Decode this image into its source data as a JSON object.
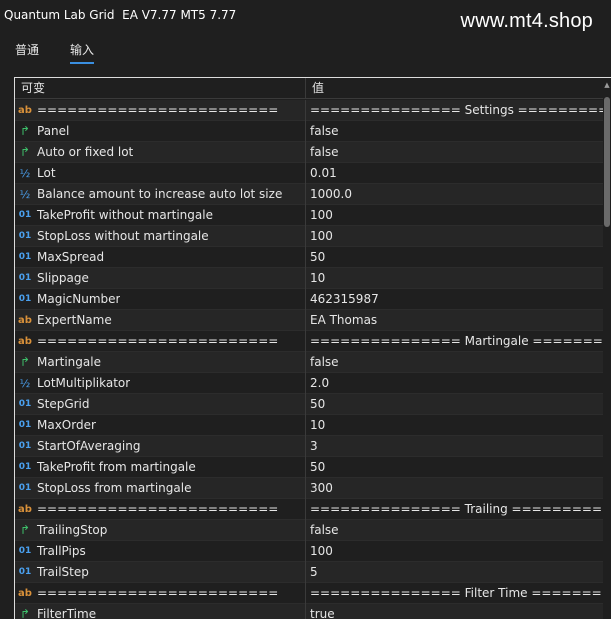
{
  "window": {
    "title": "Quantum Lab Grid  EA V7.77 MT5 7.77"
  },
  "watermark": "www.mt4.shop",
  "tabs": [
    {
      "label": "普通",
      "active": false
    },
    {
      "label": "输入",
      "active": true
    }
  ],
  "table": {
    "headers": {
      "variable": "可变",
      "value": "值"
    },
    "rows": [
      {
        "icon": "ab",
        "name": "========================",
        "value": "=============== Settings =========..."
      },
      {
        "icon": "bool",
        "name": "Panel",
        "value": "false"
      },
      {
        "icon": "bool",
        "name": "Auto or fixed lot",
        "value": "false"
      },
      {
        "icon": "half",
        "name": "Lot",
        "value": "0.01"
      },
      {
        "icon": "half",
        "name": "Balance amount to increase auto lot size",
        "value": "1000.0"
      },
      {
        "icon": "num",
        "name": "TakeProfit without martingale",
        "value": "100"
      },
      {
        "icon": "num",
        "name": "StopLoss without martingale",
        "value": "100"
      },
      {
        "icon": "num",
        "name": "MaxSpread",
        "value": "50"
      },
      {
        "icon": "num",
        "name": "Slippage",
        "value": "10"
      },
      {
        "icon": "num",
        "name": "MagicNumber",
        "value": "462315987"
      },
      {
        "icon": "ab",
        "name": "ExpertName",
        "value": "EA Thomas"
      },
      {
        "icon": "ab",
        "name": "========================",
        "value": "=============== Martingale =======..."
      },
      {
        "icon": "bool",
        "name": "Martingale",
        "value": "false"
      },
      {
        "icon": "half",
        "name": "LotMultiplikator",
        "value": "2.0"
      },
      {
        "icon": "num",
        "name": "StepGrid",
        "value": "50"
      },
      {
        "icon": "num",
        "name": "MaxOrder",
        "value": "10"
      },
      {
        "icon": "num",
        "name": "StartOfAveraging",
        "value": "3"
      },
      {
        "icon": "num",
        "name": "TakeProfit from martingale",
        "value": "50"
      },
      {
        "icon": "num",
        "name": "StopLoss from martingale",
        "value": "300"
      },
      {
        "icon": "ab",
        "name": "========================",
        "value": "=============== Trailing =========..."
      },
      {
        "icon": "bool",
        "name": "TrailingStop",
        "value": "false"
      },
      {
        "icon": "num",
        "name": "TrallPips",
        "value": "100"
      },
      {
        "icon": "num",
        "name": "TrailStep",
        "value": "5"
      },
      {
        "icon": "ab",
        "name": "========================",
        "value": "=============== Filter Time =======..."
      },
      {
        "icon": "bool",
        "name": "FilterTime",
        "value": "true"
      }
    ]
  },
  "icon_glyphs": {
    "ab": "ab",
    "num": "01",
    "half": "½",
    "bool": "↱"
  },
  "icon_names": {
    "ab": "string-type-icon",
    "num": "integer-type-icon",
    "half": "double-type-icon",
    "bool": "bool-type-icon"
  }
}
